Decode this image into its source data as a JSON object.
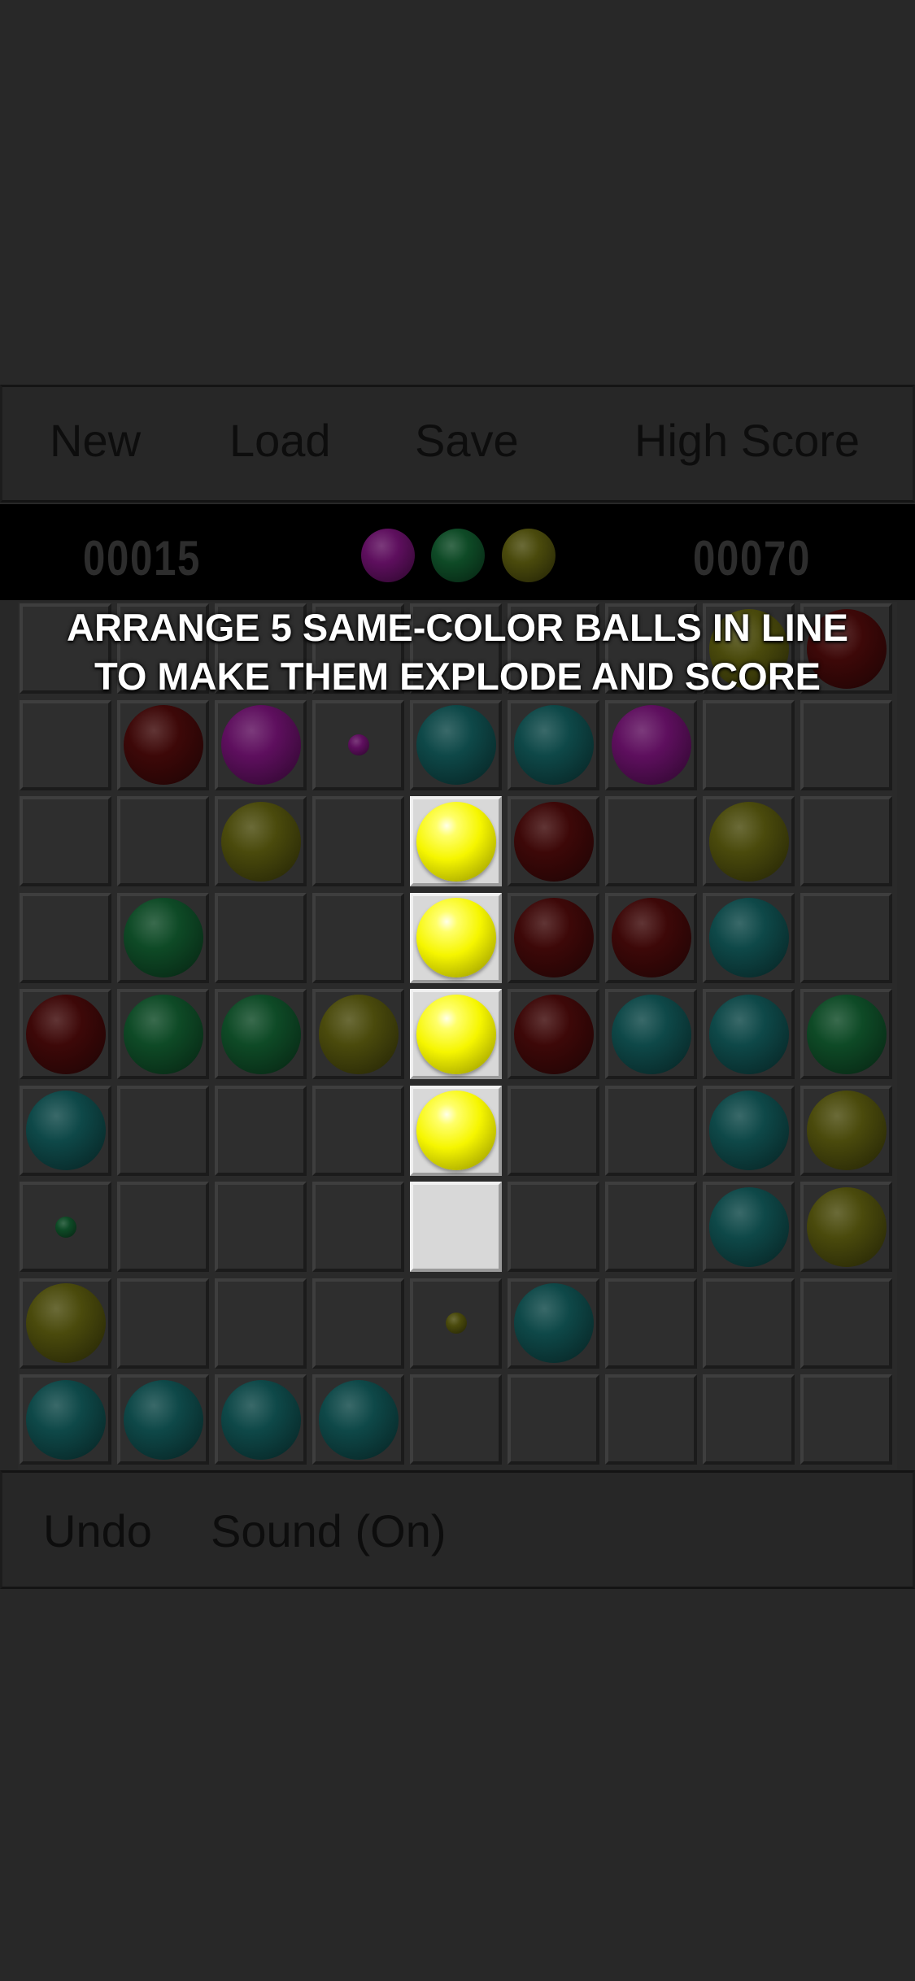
{
  "toolbar": {
    "new_label": "New",
    "load_label": "Load",
    "save_label": "Save",
    "high_score_label": "High Score"
  },
  "scorebar": {
    "current_score": "00015",
    "high_score": "00070",
    "next_balls": [
      "purple",
      "green",
      "yellow"
    ]
  },
  "hint": {
    "line1": "ARRANGE 5 SAME-COLOR BALLS IN LINE",
    "line2": "TO MAKE THEM EXPLODE AND SCORE"
  },
  "board": {
    "rows": 9,
    "cols": 9,
    "cells": [
      [
        "",
        "",
        "",
        "",
        "",
        "",
        "",
        "yellow",
        "red"
      ],
      [
        "",
        "red",
        "purple",
        "purple:small",
        "cyan",
        "cyan",
        "purple",
        "",
        ""
      ],
      [
        "",
        "",
        "yellow",
        "",
        "yellow:bright",
        "red",
        "",
        "yellow",
        ""
      ],
      [
        "",
        "green",
        "",
        "",
        "yellow:bright",
        "red",
        "red",
        "cyan",
        ""
      ],
      [
        "red",
        "green",
        "green",
        "yellow",
        "yellow:bright",
        "red",
        "cyan",
        "cyan",
        "green"
      ],
      [
        "cyan",
        "",
        "",
        "",
        "yellow:bright",
        "",
        "",
        "cyan",
        "yellow"
      ],
      [
        "green:small",
        "",
        "",
        "",
        "",
        "",
        "",
        "cyan",
        "yellow"
      ],
      [
        "yellow",
        "",
        "",
        "",
        "yellow:small",
        "cyan",
        "",
        "",
        ""
      ],
      [
        "cyan",
        "cyan",
        "cyan",
        "cyan",
        "",
        "",
        "",
        "",
        ""
      ]
    ],
    "highlighted_column": 4,
    "highlighted_rows": [
      2,
      3,
      4,
      5,
      6
    ]
  },
  "bottombar": {
    "undo_label": "Undo",
    "sound_label": "Sound",
    "sound_state": "(On)"
  },
  "colors": {
    "background": "#282828",
    "purple": "#5e0f5e",
    "green": "#0e4a26",
    "yellow": "#4a4a0c",
    "red": "#3d0808",
    "cyan": "#0e4848",
    "yellow_bright": "#f6f600"
  }
}
